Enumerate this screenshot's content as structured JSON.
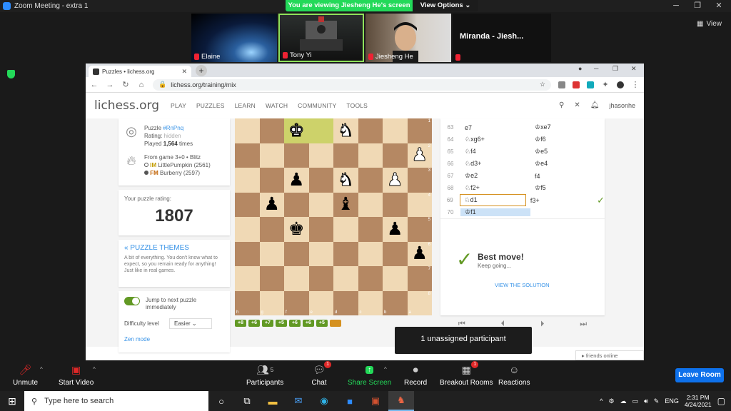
{
  "zoom": {
    "window_title": "Zoom Meeting - extra 1",
    "viewing_text": "You are viewing Jiesheng He's screen",
    "view_options": "View Options",
    "view_label": "View",
    "participants": [
      {
        "name": "Elaine"
      },
      {
        "name": "Tony Yi"
      },
      {
        "name": "Jiesheng He"
      },
      {
        "name": "Miranda - Jiesh..."
      }
    ],
    "toolbar": {
      "unmute": "Unmute",
      "start_video": "Start Video",
      "participants": "Participants",
      "participants_count": "5",
      "chat": "Chat",
      "chat_badge": "1",
      "share_screen": "Share Screen",
      "record": "Record",
      "breakout": "Breakout Rooms",
      "breakout_badge": "1",
      "reactions": "Reactions",
      "leave": "Leave Room"
    },
    "tooltip": "1 unassigned participant"
  },
  "browser": {
    "tab_title": "Puzzles • lichess.org",
    "url": "lichess.org/training/mix"
  },
  "lichess": {
    "logo": "lichess.org",
    "nav": [
      "PLAY",
      "PUZZLES",
      "LEARN",
      "WATCH",
      "COMMUNITY",
      "TOOLS"
    ],
    "username": "jhasonhe",
    "puzzle": {
      "label": "Puzzle",
      "id": "#RnPnq",
      "rating_label": "Rating:",
      "rating_value": "hidden",
      "played_prefix": "Played",
      "played_count": "1,564",
      "played_suffix": "times",
      "from_game": "From game 3+0 • Blitz",
      "white_title": "IM",
      "white_player": "LittlePumpkin (2561)",
      "black_title": "FM",
      "black_player": "Burberry (2597)"
    },
    "your_rating_label": "Your puzzle rating:",
    "your_rating": "1807",
    "themes_title": "« PUZZLE THEMES",
    "themes_desc": "A bit of everything. You don't know what to expect, so you remain ready for anything! Just like in real games.",
    "jump_label": "Jump to next puzzle immediately",
    "difficulty_label": "Difficulty level",
    "difficulty_value": "Easier",
    "zen_mode": "Zen mode",
    "streak": [
      "+8",
      "+6",
      "+7",
      "+5",
      "+6",
      "+6",
      "+5"
    ],
    "moves": [
      {
        "num": "63",
        "w": "e7",
        "b": "♔xe7"
      },
      {
        "num": "64",
        "w": "♘xg6+",
        "b": "♔f6"
      },
      {
        "num": "65",
        "w": "♘f4",
        "b": "♔e5"
      },
      {
        "num": "66",
        "w": "♘d3+",
        "b": "♔e4"
      },
      {
        "num": "67",
        "w": "♔e2",
        "b": "f4"
      },
      {
        "num": "68",
        "w": "♘f2+",
        "b": "♔f5"
      },
      {
        "num": "69",
        "w": "♘d1",
        "b": "f3+"
      },
      {
        "num": "70",
        "w": "♔f1",
        "b": ""
      }
    ],
    "check_icon": "✓",
    "best_move": "Best move!",
    "keep_going": "Keep going...",
    "view_solution": "VIEW THE SOLUTION",
    "friends_online": "▸ friends online",
    "board": {
      "ranks": [
        "1",
        "2",
        "3",
        "4",
        "5",
        "6",
        "7",
        "8"
      ],
      "files": [
        "h",
        "g",
        "f",
        "e",
        "d",
        "c",
        "b",
        "a"
      ]
    }
  },
  "taskbar": {
    "search_placeholder": "Type here to search",
    "lang": "ENG",
    "time": "2:31 PM",
    "date": "4/24/2021"
  }
}
